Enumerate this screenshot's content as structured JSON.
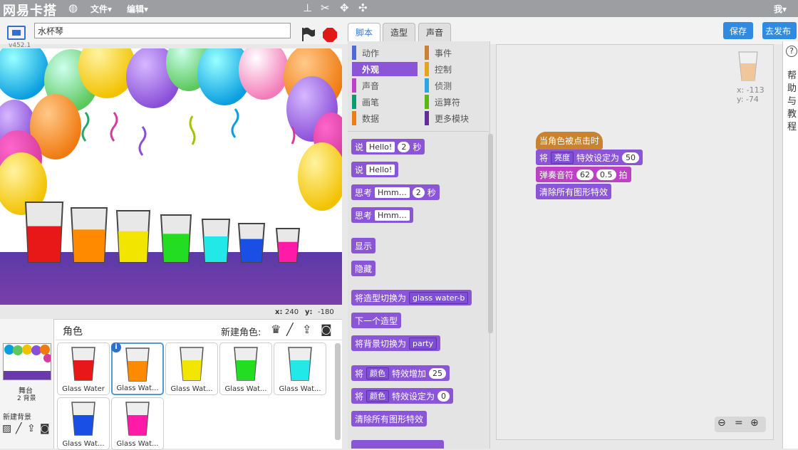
{
  "menubar": {
    "logo": "网易卡搭",
    "file": "文件▾",
    "edit": "编辑▾",
    "user": "我▾"
  },
  "project": {
    "title": "水杯琴",
    "version": "v452.1"
  },
  "stage": {
    "x_label": "x:",
    "x": "240",
    "y_label": "y:",
    "y": "-180"
  },
  "sprites": {
    "header": "角色",
    "new_sprite": "新建角色:",
    "stage_label": "舞台",
    "backdrops": "2 背景",
    "new_backdrop": "新建背景",
    "items": [
      {
        "name": "Glass Water",
        "color": "#e81818"
      },
      {
        "name": "Glass Wat...",
        "color": "#ff8a00"
      },
      {
        "name": "Glass Wat...",
        "color": "#f2e600"
      },
      {
        "name": "Glass Wat...",
        "color": "#22dd22"
      },
      {
        "name": "Glass Wat...",
        "color": "#22e8e8"
      },
      {
        "name": "Glass Wat...",
        "color": "#1a4fe6"
      },
      {
        "name": "Glass Wat...",
        "color": "#ff1aa8"
      }
    ]
  },
  "tabs": {
    "scripts": "脚本",
    "costumes": "造型",
    "sounds": "声音"
  },
  "categories": {
    "motion": "动作",
    "looks": "外观",
    "sound": "声音",
    "pen": "画笔",
    "data": "数据",
    "events": "事件",
    "control": "控制",
    "sensing": "侦测",
    "operators": "运算符",
    "more": "更多模块"
  },
  "palette": {
    "say": "说",
    "say_val": "Hello!",
    "secs_val": "2",
    "secs": "秒",
    "think": "思考",
    "think_val": "Hmm…",
    "show": "显示",
    "hide": "隐藏",
    "switch_costume": "将造型切换为",
    "costume_val": "glass water-b",
    "next_costume": "下一个造型",
    "switch_backdrop": "将背景切换为",
    "backdrop_val": "party",
    "set": "将",
    "effect_color": "颜色",
    "change_effect_by": "特效增加",
    "change_val": "25",
    "set_effect_to": "特效设定为",
    "set_val": "0",
    "clear_effects": "清除所有图形特效"
  },
  "script": {
    "hat": "当角色被点击时",
    "set": "将",
    "effect": "亮度",
    "set_to": "特效设定为",
    "effect_val": "50",
    "play_note": "弹奏音符",
    "note": "62",
    "beats": "0.5",
    "beat_unit": "拍",
    "clear": "清除所有图形特效",
    "sprite_x": "x: -113",
    "sprite_y": "y: -74"
  },
  "buttons": {
    "save": "保存",
    "publish": "去发布"
  },
  "help": {
    "icon": "?",
    "text": "帮助与教程"
  }
}
